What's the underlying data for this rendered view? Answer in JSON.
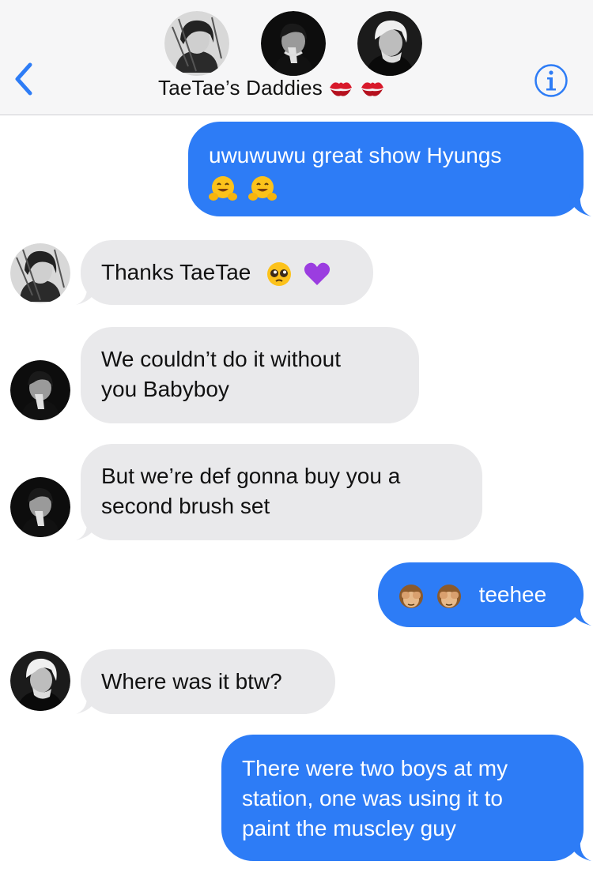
{
  "header": {
    "title": "TaeTae’s Daddies",
    "title_emoji": [
      "kiss-mark-emoji",
      "kiss-mark-emoji"
    ],
    "back_icon": "chevron-left-icon",
    "info_icon": "info-icon",
    "accent_color": "#2d7cf6"
  },
  "messages": [
    {
      "sender": "me",
      "text": "uwuwuwu great show Hyungs",
      "emoji": [
        "hugging-face-emoji",
        "hugging-face-emoji"
      ]
    },
    {
      "sender": "member-1",
      "text": "Thanks TaeTae",
      "emoji": [
        "pleading-face-emoji",
        "purple-heart-emoji"
      ]
    },
    {
      "sender": "member-2",
      "text": "We couldn’t do it without\nyou Babyboy"
    },
    {
      "sender": "member-2",
      "text": "But we’re def gonna buy you a\nsecond brush set"
    },
    {
      "sender": "me",
      "text": "teehee",
      "emoji": [
        "see-no-evil-monkey-emoji",
        "see-no-evil-monkey-emoji"
      ]
    },
    {
      "sender": "member-3",
      "text": "Where was it btw?"
    },
    {
      "sender": "me",
      "text": "There were two boys at my\nstation, one was using it to\npaint the muscley guy"
    }
  ],
  "colors": {
    "outgoing_bubble": "#2d7cf6",
    "incoming_bubble": "#e9e9eb",
    "header_bg": "#f6f6f7"
  }
}
